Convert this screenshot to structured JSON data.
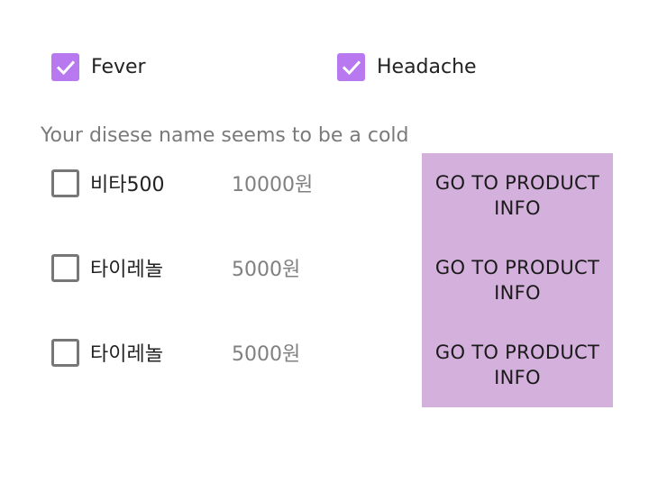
{
  "symptoms": [
    {
      "label": "Fever",
      "checked": true
    },
    {
      "label": "Headache",
      "checked": true
    }
  ],
  "diagnosis_text": "Your disese name seems to be a cold",
  "products": [
    {
      "name": "비타500",
      "price": "10000원",
      "button_label": "GO TO PRODUCT INFO",
      "checked": false
    },
    {
      "name": "타이레놀",
      "price": "5000원",
      "button_label": "GO TO PRODUCT INFO",
      "checked": false
    },
    {
      "name": "타이레놀",
      "price": "5000원",
      "button_label": "GO TO PRODUCT INFO",
      "checked": false
    }
  ],
  "colors": {
    "checkbox_checked": "#b878f0",
    "checkbox_unchecked_border": "#777777",
    "button_bg": "#d4b0dc"
  },
  "icons": {
    "checked": "checkmark-icon"
  }
}
